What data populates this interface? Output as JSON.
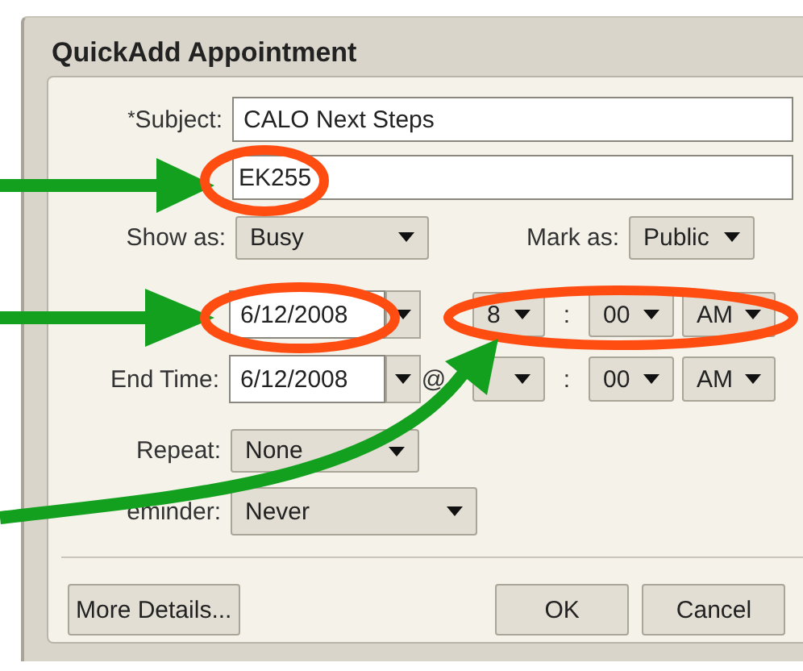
{
  "window": {
    "title": "QuickAdd Appointment"
  },
  "subject": {
    "mark": "*",
    "label": "Subject:",
    "value": "CALO Next Steps"
  },
  "location": {
    "value": "EK255"
  },
  "show_as": {
    "label": "Show as:",
    "value": "Busy"
  },
  "mark_as": {
    "label": "Mark as:",
    "value": "Public"
  },
  "start": {
    "date": "6/12/2008",
    "hour": "8",
    "separator": ":",
    "minute": "00",
    "period": "AM"
  },
  "end": {
    "label": "End Time:",
    "date": "6/12/2008",
    "at": "@",
    "separator": ":",
    "minute": "00",
    "period": "AM"
  },
  "repeat": {
    "label": "Repeat:",
    "value": "None"
  },
  "reminder": {
    "label": "eminder:",
    "value": "Never"
  },
  "buttons": [
    {
      "label": "More Details..."
    },
    {
      "label": "OK"
    },
    {
      "label": "Cancel"
    }
  ],
  "annotations": [
    {
      "kind": "arrow"
    },
    {
      "kind": "ellipse"
    },
    {
      "kind": "arrow"
    },
    {
      "kind": "ellipse"
    },
    {
      "kind": "ellipse"
    },
    {
      "kind": "curved-arrow"
    }
  ]
}
